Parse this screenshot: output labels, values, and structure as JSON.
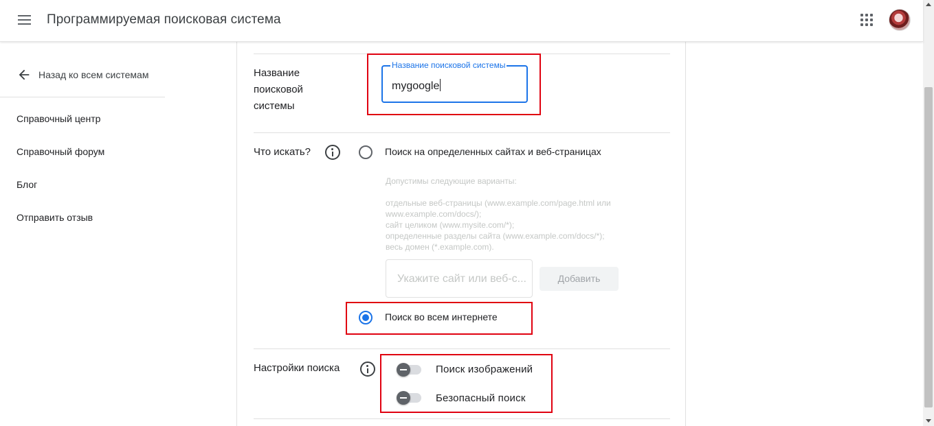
{
  "header": {
    "title": "Программируемая поисковая система",
    "menu_icon": "hamburger-menu-icon",
    "apps_icon": "apps-grid-icon",
    "avatar_icon": "user-avatar"
  },
  "sidebar": {
    "back_label": "Назад ко всем системам",
    "back_icon": "arrow-left-icon",
    "items": [
      {
        "label": "Справочный центр"
      },
      {
        "label": "Справочный форум"
      },
      {
        "label": "Блог"
      },
      {
        "label": "Отправить отзыв"
      }
    ]
  },
  "engine_name": {
    "row_label_lines": [
      "Название",
      "поисковой",
      "системы"
    ],
    "field_label": "Название поисковой системы",
    "field_value": "mygoogle"
  },
  "what_to_search": {
    "row_label": "Что искать?",
    "option_sites": {
      "label": "Поиск на определенных сайтах и веб-страницах",
      "selected": false
    },
    "hint_lines": [
      "Допустимы следующие варианты:",
      "",
      "отдельные веб-страницы (www.example.com/page.html или",
      "www.example.com/docs/);",
      "сайт целиком (www.mysite.com/*);",
      "определенные разделы сайта (www.example.com/docs/*);",
      "весь домен (*.example.com)."
    ],
    "site_input_placeholder": "Укажите сайт или веб-с...",
    "add_button": "Добавить",
    "option_web": {
      "label": "Поиск во всем интернете",
      "selected": true
    }
  },
  "search_settings": {
    "row_label": "Настройки поиска",
    "toggles": [
      {
        "label": "Поиск изображений",
        "on": false
      },
      {
        "label": "Безопасный поиск",
        "on": false
      }
    ]
  },
  "colors": {
    "accent": "#1a73e8",
    "highlight": "#e0000f"
  }
}
